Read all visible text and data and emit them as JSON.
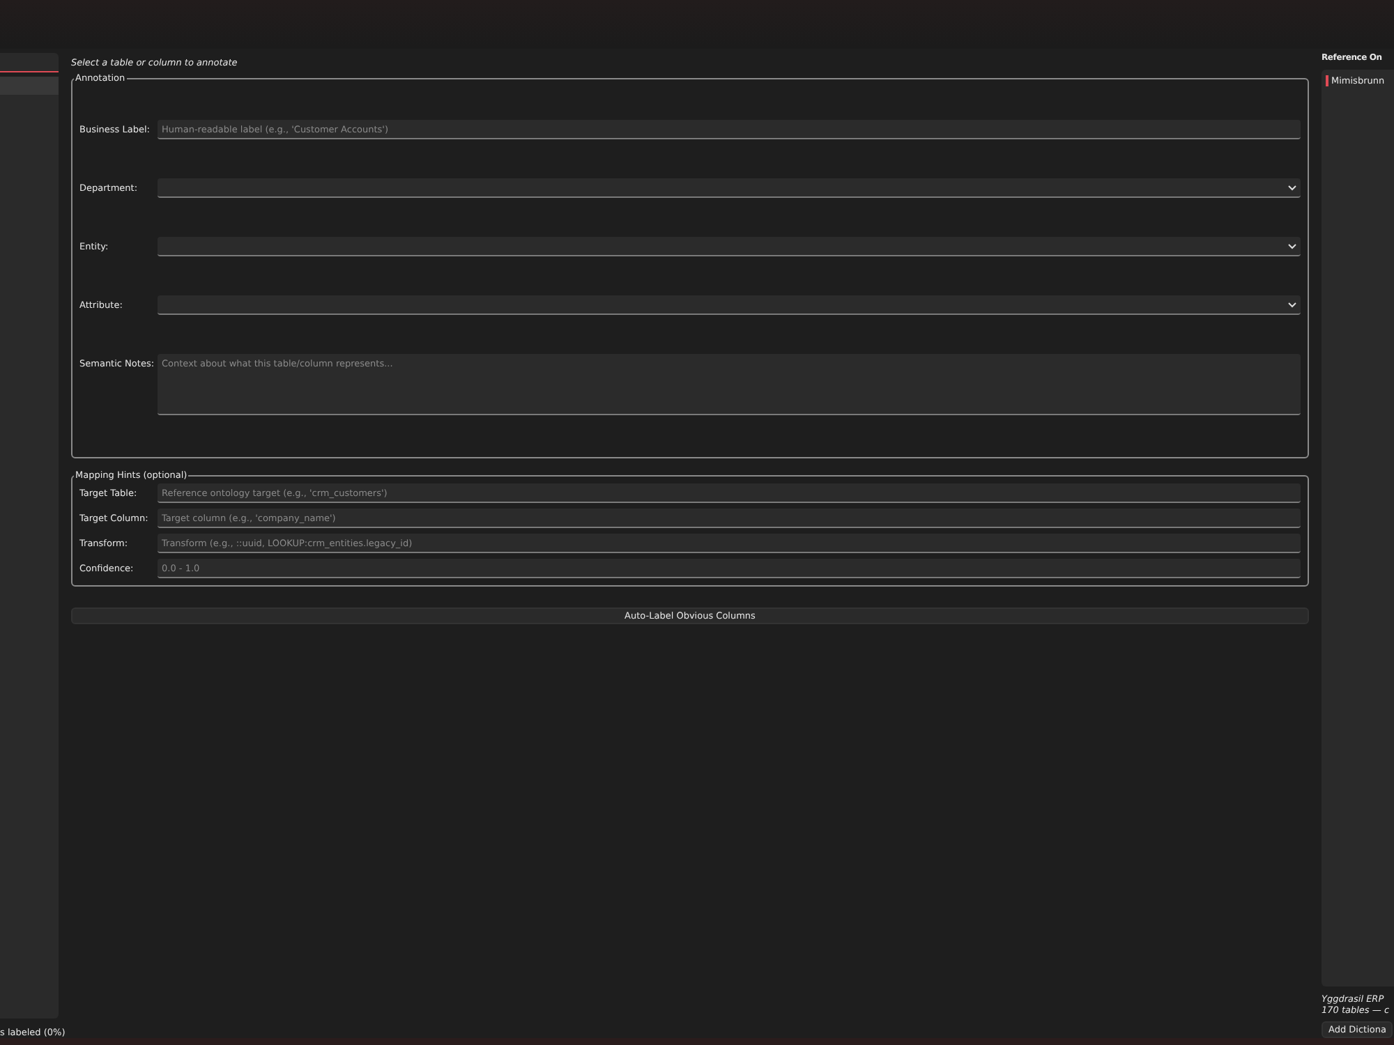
{
  "left_panel": {
    "footer": "s labeled (0%)"
  },
  "hint": "Select a table or column to annotate",
  "annotation": {
    "title": "Annotation",
    "fields": [
      {
        "kind": "input",
        "label": "Business Label:",
        "placeholder": "Human-readable label (e.g., 'Customer Accounts')"
      },
      {
        "kind": "select",
        "label": "Department:"
      },
      {
        "kind": "select",
        "label": "Entity:"
      },
      {
        "kind": "select",
        "label": "Attribute:"
      },
      {
        "kind": "textarea",
        "label": "Semantic Notes:",
        "placeholder": "Context about what this table/column represents..."
      }
    ]
  },
  "mapping_hints": {
    "title": "Mapping Hints (optional)",
    "fields": [
      {
        "label": "Target Table:",
        "placeholder": "Reference ontology target (e.g., 'crm_customers')"
      },
      {
        "label": "Target Column:",
        "placeholder": "Target column (e.g., 'company_name')"
      },
      {
        "label": "Transform:",
        "placeholder": "Transform (e.g., ::uuid, LOOKUP:crm_entities.legacy_id)"
      },
      {
        "label": "Confidence:",
        "placeholder": "0.0 - 1.0"
      }
    ]
  },
  "auto_label_button": "Auto-Label Obvious Columns",
  "right_panel": {
    "title": "Reference On",
    "items": [
      {
        "label": "Mimisbrunn",
        "selected": true
      }
    ],
    "info_lines": [
      "Yggdrasil ERP",
      "170 tables — c"
    ],
    "button": "Add Dictiona"
  }
}
